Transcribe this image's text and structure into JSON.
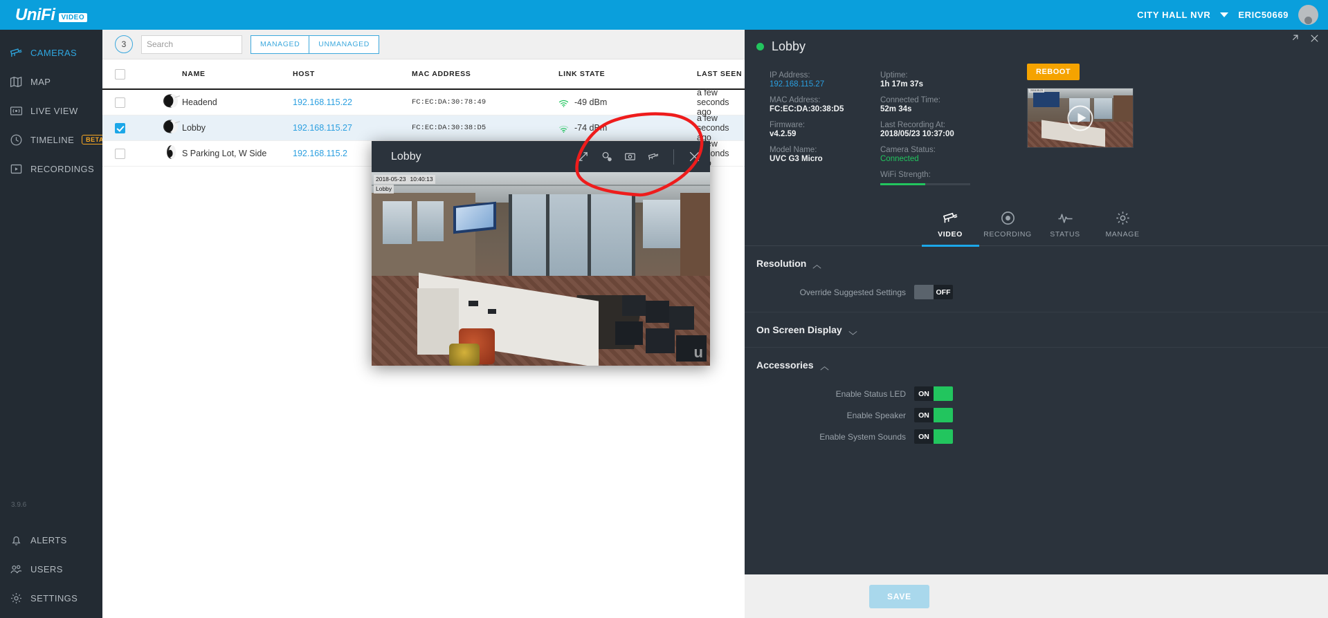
{
  "topbar": {
    "logo_text": "UniFi",
    "logo_badge": "VIDEO",
    "nvr_name": "CITY HALL NVR",
    "user_name": "ERIC50669"
  },
  "sidebar": {
    "items": [
      {
        "label": "CAMERAS",
        "icon": "camera-icon",
        "active": true
      },
      {
        "label": "MAP",
        "icon": "map-icon",
        "active": false
      },
      {
        "label": "LIVE VIEW",
        "icon": "live-view-icon",
        "active": false
      },
      {
        "label": "TIMELINE",
        "icon": "clock-icon",
        "active": false,
        "badge": "BETA"
      },
      {
        "label": "RECORDINGS",
        "icon": "play-box-icon",
        "active": false
      }
    ],
    "version": "3.9.6",
    "bottom_items": [
      {
        "label": "ALERTS",
        "icon": "bell-icon"
      },
      {
        "label": "USERS",
        "icon": "users-icon"
      },
      {
        "label": "SETTINGS",
        "icon": "gear-icon"
      }
    ]
  },
  "toolbar": {
    "count": "3",
    "search_placeholder": "Search",
    "search_value": "",
    "managed_label": "MANAGED",
    "unmanaged_label": "UNMANAGED"
  },
  "table": {
    "columns": [
      "NAME",
      "HOST",
      "MAC ADDRESS",
      "LINK STATE",
      "LAST SEEN"
    ],
    "rows": [
      {
        "selected": false,
        "status": "online",
        "name": "Headend",
        "host": "192.168.115.22",
        "mac": "FC:EC:DA:30:78:49",
        "link": "-49 dBm",
        "last_seen": "a few seconds ago"
      },
      {
        "selected": true,
        "status": "online",
        "name": "Lobby",
        "host": "192.168.115.27",
        "mac": "FC:EC:DA:30:38:D5",
        "link": "-74 dBm",
        "last_seen": "a few seconds ago"
      },
      {
        "selected": false,
        "status": "online",
        "name": "S Parking Lot, W Side",
        "host": "192.168.115.2",
        "mac": "",
        "link": "",
        "last_seen": "a few seconds ago"
      }
    ]
  },
  "modal": {
    "title": "Lobby",
    "osd_date": "2018-05-23",
    "osd_time": "10:40:13",
    "osd_name": "Lobby",
    "tools": [
      "expand-icon",
      "zoom-settings-icon",
      "snapshot-icon",
      "camera-config-icon",
      "close-icon"
    ]
  },
  "panel": {
    "title": "Lobby",
    "status": "online",
    "info": {
      "ip_address_label": "IP Address:",
      "ip_address": "192.168.115.27",
      "mac_address_label": "MAC Address:",
      "mac_address": "FC:EC:DA:30:38:D5",
      "firmware_label": "Firmware:",
      "firmware": "v4.2.59",
      "model_label": "Model Name:",
      "model": "UVC G3 Micro",
      "uptime_label": "Uptime:",
      "uptime": "1h 17m 37s",
      "connected_time_label": "Connected Time:",
      "connected_time": "52m 34s",
      "last_recording_label": "Last Recording At:",
      "last_recording": "2018/05/23 10:37:00",
      "camera_status_label": "Camera Status:",
      "camera_status": "Connected",
      "wifi_strength_label": "WiFi Strength:",
      "wifi_strength_pct": 50
    },
    "reboot_label": "REBOOT",
    "tabs": [
      {
        "label": "VIDEO",
        "icon": "camera-icon",
        "active": true
      },
      {
        "label": "RECORDING",
        "icon": "record-icon",
        "active": false
      },
      {
        "label": "STATUS",
        "icon": "pulse-icon",
        "active": false
      },
      {
        "label": "MANAGE",
        "icon": "gear-icon",
        "active": false
      }
    ],
    "sections": [
      {
        "title": "Resolution",
        "expanded": true,
        "fields": [
          {
            "label": "Override Suggested Settings",
            "state": "OFF"
          }
        ]
      },
      {
        "title": "On Screen Display",
        "expanded": false,
        "fields": []
      },
      {
        "title": "Accessories",
        "expanded": true,
        "fields": [
          {
            "label": "Enable Status LED",
            "state": "ON"
          },
          {
            "label": "Enable Speaker",
            "state": "ON"
          },
          {
            "label": "Enable System Sounds",
            "state": "ON"
          }
        ]
      }
    ],
    "save_label": "SAVE"
  },
  "colors": {
    "brand_blue": "#0a9fdc",
    "accent_blue": "#1ca7e8",
    "panel_dark": "#2b333c",
    "sidebar_dark": "#232b33",
    "status_green": "#22c55e",
    "warn_orange": "#f5a300",
    "annotation_red": "#ee1c1c"
  }
}
